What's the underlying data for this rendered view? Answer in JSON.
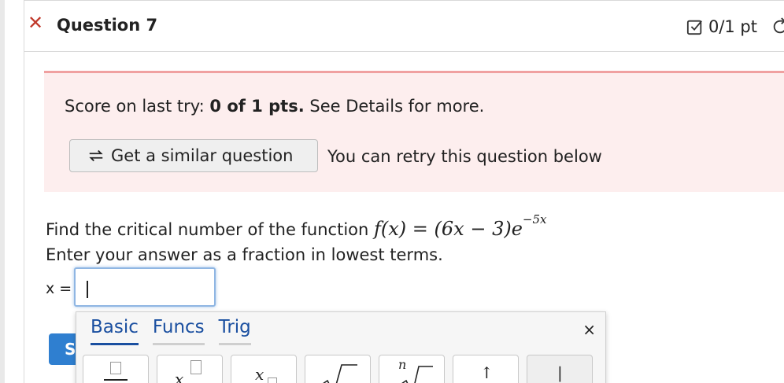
{
  "question": {
    "title": "Question 7",
    "score": "0/1 pt"
  },
  "feedback": {
    "score_prefix": "Score on last try: ",
    "score_value": "0 of 1 pts.",
    "score_suffix": " See Details for more.",
    "similar_button_label": "Get a similar question",
    "retry_note": "You can retry this question below"
  },
  "problem": {
    "prompt_text": "Find the critical number of the function ",
    "function_lhs": "f(x)",
    "function_eq": " = ",
    "function_rhs": "(6x − 3)e",
    "exponent": "−5x",
    "instruction": "Enter your answer as a fraction in lowest terms.",
    "answer_label": "x =",
    "answer_value": ""
  },
  "submit": {
    "label_visible": "S"
  },
  "keyboard": {
    "tabs": [
      "Basic",
      "Funcs",
      "Trig"
    ],
    "active_tab": "Basic",
    "close_glyph": "×",
    "keys": [
      "fraction-key",
      "x-power-key",
      "x-subscript-key",
      "sqrt-key",
      "nth-root-key",
      "up-arrow-key",
      "pipe-key"
    ],
    "key_glyphs": {
      "x_power": "x",
      "x_subscript": "x",
      "nth_root_index": "n",
      "up_arrow": "↑",
      "pipe": "|"
    }
  },
  "colors": {
    "close_red": "#c0392b",
    "feedback_bg": "#fdeeee",
    "feedback_border": "#f0a0a0",
    "link_blue": "#1a4fa0",
    "submit_blue": "#2f7fd0",
    "focus_blue": "#8fb6e3"
  }
}
